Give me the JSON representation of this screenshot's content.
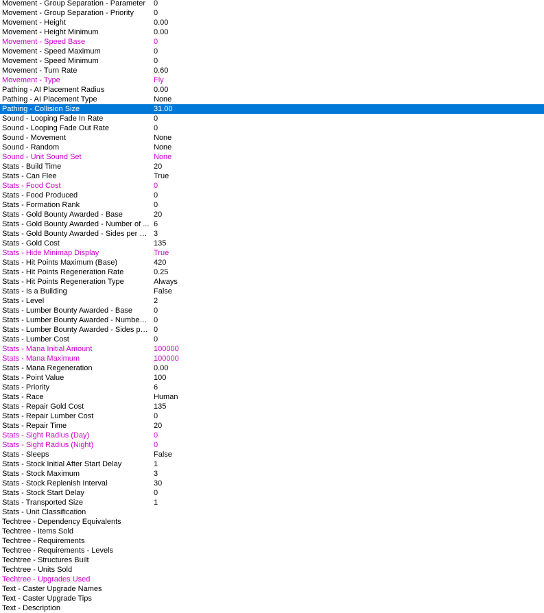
{
  "colors": {
    "modified_text": "#cc00cc",
    "selection_background": "#0078d7",
    "selection_text": "#ffffff",
    "default_text": "#000000",
    "background": "#ffffff"
  },
  "fields": [
    {
      "name": "Movement - Group Separation - Parameter",
      "value": "0",
      "modified": false,
      "selected": false
    },
    {
      "name": "Movement - Group Separation - Priority",
      "value": "0",
      "modified": false,
      "selected": false
    },
    {
      "name": "Movement - Height",
      "value": "0.00",
      "modified": false,
      "selected": false
    },
    {
      "name": "Movement - Height Minimum",
      "value": "0.00",
      "modified": false,
      "selected": false
    },
    {
      "name": "Movement - Speed Base",
      "value": "0",
      "modified": true,
      "selected": false
    },
    {
      "name": "Movement - Speed Maximum",
      "value": "0",
      "modified": false,
      "selected": false
    },
    {
      "name": "Movement - Speed Minimum",
      "value": "0",
      "modified": false,
      "selected": false
    },
    {
      "name": "Movement - Turn Rate",
      "value": "0.60",
      "modified": false,
      "selected": false
    },
    {
      "name": "Movement - Type",
      "value": "Fly",
      "modified": true,
      "selected": false
    },
    {
      "name": "Pathing - AI Placement Radius",
      "value": "0.00",
      "modified": false,
      "selected": false
    },
    {
      "name": "Pathing - AI Placement Type",
      "value": "None",
      "modified": false,
      "selected": false
    },
    {
      "name": "Pathing - Collision Size",
      "value": "31.00",
      "modified": true,
      "selected": true
    },
    {
      "name": "Sound - Looping Fade In Rate",
      "value": "0",
      "modified": false,
      "selected": false
    },
    {
      "name": "Sound - Looping Fade Out Rate",
      "value": "0",
      "modified": false,
      "selected": false
    },
    {
      "name": "Sound - Movement",
      "value": "None",
      "modified": false,
      "selected": false
    },
    {
      "name": "Sound - Random",
      "value": "None",
      "modified": false,
      "selected": false
    },
    {
      "name": "Sound - Unit Sound Set",
      "value": "None",
      "modified": true,
      "selected": false
    },
    {
      "name": "Stats - Build Time",
      "value": "20",
      "modified": false,
      "selected": false
    },
    {
      "name": "Stats - Can Flee",
      "value": "True",
      "modified": false,
      "selected": false
    },
    {
      "name": "Stats - Food Cost",
      "value": "0",
      "modified": true,
      "selected": false
    },
    {
      "name": "Stats - Food Produced",
      "value": "0",
      "modified": false,
      "selected": false
    },
    {
      "name": "Stats - Formation Rank",
      "value": "0",
      "modified": false,
      "selected": false
    },
    {
      "name": "Stats - Gold Bounty Awarded - Base",
      "value": "20",
      "modified": false,
      "selected": false
    },
    {
      "name": "Stats - Gold Bounty Awarded - Number of ...",
      "value": "6",
      "modified": false,
      "selected": false
    },
    {
      "name": "Stats - Gold Bounty Awarded - Sides per Die",
      "value": "3",
      "modified": false,
      "selected": false
    },
    {
      "name": "Stats - Gold Cost",
      "value": "135",
      "modified": false,
      "selected": false
    },
    {
      "name": "Stats - Hide Minimap Display",
      "value": "True",
      "modified": true,
      "selected": false
    },
    {
      "name": "Stats - Hit Points Maximum (Base)",
      "value": "420",
      "modified": false,
      "selected": false
    },
    {
      "name": "Stats - Hit Points Regeneration Rate",
      "value": "0.25",
      "modified": false,
      "selected": false
    },
    {
      "name": "Stats - Hit Points Regeneration Type",
      "value": "Always",
      "modified": false,
      "selected": false
    },
    {
      "name": "Stats - Is a Building",
      "value": "False",
      "modified": false,
      "selected": false
    },
    {
      "name": "Stats - Level",
      "value": "2",
      "modified": false,
      "selected": false
    },
    {
      "name": "Stats - Lumber Bounty Awarded - Base",
      "value": "0",
      "modified": false,
      "selected": false
    },
    {
      "name": "Stats - Lumber Bounty Awarded - Number o...",
      "value": "0",
      "modified": false,
      "selected": false
    },
    {
      "name": "Stats - Lumber Bounty Awarded - Sides per...",
      "value": "0",
      "modified": false,
      "selected": false
    },
    {
      "name": "Stats - Lumber Cost",
      "value": "0",
      "modified": false,
      "selected": false
    },
    {
      "name": "Stats - Mana Initial Amount",
      "value": "100000",
      "modified": true,
      "selected": false
    },
    {
      "name": "Stats - Mana Maximum",
      "value": "100000",
      "modified": true,
      "selected": false
    },
    {
      "name": "Stats - Mana Regeneration",
      "value": "0.00",
      "modified": false,
      "selected": false
    },
    {
      "name": "Stats - Point Value",
      "value": "100",
      "modified": false,
      "selected": false
    },
    {
      "name": "Stats - Priority",
      "value": "6",
      "modified": false,
      "selected": false
    },
    {
      "name": "Stats - Race",
      "value": "Human",
      "modified": false,
      "selected": false
    },
    {
      "name": "Stats - Repair Gold Cost",
      "value": "135",
      "modified": false,
      "selected": false
    },
    {
      "name": "Stats - Repair Lumber Cost",
      "value": "0",
      "modified": false,
      "selected": false
    },
    {
      "name": "Stats - Repair Time",
      "value": "20",
      "modified": false,
      "selected": false
    },
    {
      "name": "Stats - Sight Radius (Day)",
      "value": "0",
      "modified": true,
      "selected": false
    },
    {
      "name": "Stats - Sight Radius (Night)",
      "value": "0",
      "modified": true,
      "selected": false
    },
    {
      "name": "Stats - Sleeps",
      "value": "False",
      "modified": false,
      "selected": false
    },
    {
      "name": "Stats - Stock Initial After Start Delay",
      "value": "1",
      "modified": false,
      "selected": false
    },
    {
      "name": "Stats - Stock Maximum",
      "value": "3",
      "modified": false,
      "selected": false
    },
    {
      "name": "Stats - Stock Replenish Interval",
      "value": "30",
      "modified": false,
      "selected": false
    },
    {
      "name": "Stats - Stock Start Delay",
      "value": "0",
      "modified": false,
      "selected": false
    },
    {
      "name": "Stats - Transported Size",
      "value": "1",
      "modified": false,
      "selected": false
    },
    {
      "name": "Stats - Unit Classification",
      "value": "",
      "modified": false,
      "selected": false
    },
    {
      "name": "Techtree - Dependency Equivalents",
      "value": "",
      "modified": false,
      "selected": false
    },
    {
      "name": "Techtree - Items Sold",
      "value": "",
      "modified": false,
      "selected": false
    },
    {
      "name": "Techtree - Requirements",
      "value": "",
      "modified": false,
      "selected": false
    },
    {
      "name": "Techtree - Requirements - Levels",
      "value": "",
      "modified": false,
      "selected": false
    },
    {
      "name": "Techtree - Structures Built",
      "value": "",
      "modified": false,
      "selected": false
    },
    {
      "name": "Techtree - Units Sold",
      "value": "",
      "modified": false,
      "selected": false
    },
    {
      "name": "Techtree - Upgrades Used",
      "value": "",
      "modified": true,
      "selected": false
    },
    {
      "name": "Text - Caster Upgrade Names",
      "value": "",
      "modified": false,
      "selected": false
    },
    {
      "name": "Text - Caster Upgrade Tips",
      "value": "",
      "modified": false,
      "selected": false
    },
    {
      "name": "Text - Description",
      "value": "",
      "modified": false,
      "selected": false
    }
  ]
}
